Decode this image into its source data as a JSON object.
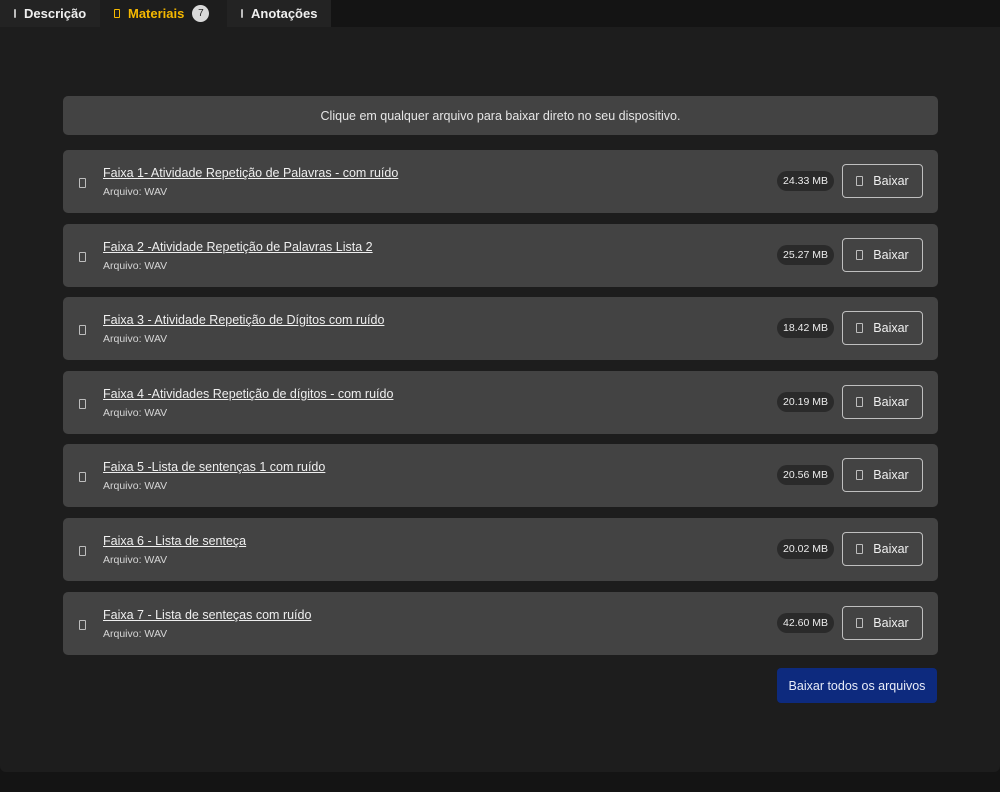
{
  "tabs": [
    {
      "label": "Descrição",
      "icon": "document-icon"
    },
    {
      "label": "Materiais",
      "icon": "folder-icon",
      "count": "7",
      "active": true
    },
    {
      "label": "Anotações",
      "icon": "note-icon"
    }
  ],
  "notice": "Clique em qualquer arquivo para baixar direto no seu dispositivo.",
  "files": [
    {
      "name": "Faixa 1- Atividade Repetição de Palavras - com ruído",
      "type": "Arquivo: WAV",
      "size": "24.33 MB",
      "button": "Baixar"
    },
    {
      "name": "Faixa 2 -Atividade Repetição de Palavras Lista 2",
      "type": "Arquivo: WAV",
      "size": "25.27 MB",
      "button": "Baixar"
    },
    {
      "name": "Faixa 3 - Atividade Repetição de Dígitos com ruído",
      "type": "Arquivo: WAV",
      "size": "18.42 MB",
      "button": "Baixar"
    },
    {
      "name": "Faixa 4 -Atividades Repetição de dígitos - com ruído",
      "type": "Arquivo: WAV",
      "size": "20.19 MB",
      "button": "Baixar"
    },
    {
      "name": "Faixa 5 -Lista de sentenças 1 com ruído",
      "type": "Arquivo: WAV",
      "size": "20.56 MB",
      "button": "Baixar"
    },
    {
      "name": "Faixa 6 - Lista de senteça",
      "type": "Arquivo: WAV",
      "size": "20.02 MB",
      "button": "Baixar"
    },
    {
      "name": "Faixa 7 - Lista de senteças com ruído",
      "type": "Arquivo: WAV",
      "size": "42.60 MB",
      "button": "Baixar"
    }
  ],
  "download_all": "Baixar todos os arquivos",
  "colors": {
    "accent": "#f5b800",
    "primary_button": "#0d2a7e",
    "panel": "#1d1d1d",
    "card": "#434343"
  }
}
